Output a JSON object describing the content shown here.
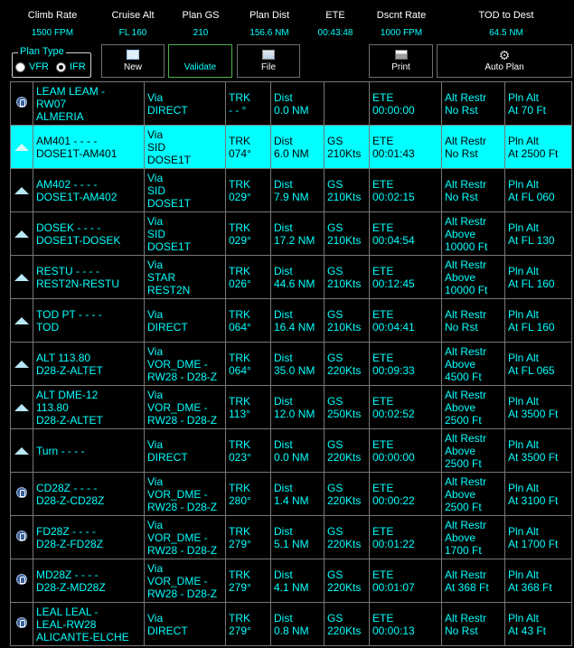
{
  "summary": [
    {
      "label": "Climb Rate",
      "value": "1500 FPM"
    },
    {
      "label": "Cruise Alt",
      "value": "FL 160"
    },
    {
      "label": "Plan GS",
      "value": "210"
    },
    {
      "label": "Plan Dist",
      "value": "156.6 NM"
    },
    {
      "label": "ETE",
      "value": "00:43:48"
    },
    {
      "label": "Dscnt Rate",
      "value": "1000 FPM"
    },
    {
      "label": "TOD to Dest",
      "value": "64.5 NM"
    }
  ],
  "plan_type": {
    "legend": "Plan Type",
    "vfr_label": "VFR",
    "ifr_label": "IFR",
    "selected": "IFR"
  },
  "toolbar": {
    "new_label": "New",
    "validate_label": "Validate",
    "file_label": "File",
    "print_label": "Print",
    "autoplan_label": "Auto Plan"
  },
  "rows": [
    {
      "icon": "airport-icon",
      "wpt": [
        "LEAM  LEAM -",
        "RW07",
        "ALMERIA"
      ],
      "via": [
        "Via",
        "DIRECT"
      ],
      "trk": [
        "TRK",
        "- - °"
      ],
      "dist": [
        "Dist",
        "0.0 NM"
      ],
      "gs": [],
      "ete": [
        "ETE",
        "00:00:00"
      ],
      "alt": [
        "Alt Restr",
        "No Rst"
      ],
      "pln": [
        "Pln Alt",
        "At 70 Ft"
      ],
      "selected": false
    },
    {
      "icon": "waypoint-icon",
      "wpt": [
        "AM401   - - - -",
        "DOSE1T-AM401"
      ],
      "via": [
        "Via",
        "SID",
        "DOSE1T"
      ],
      "trk": [
        "TRK",
        "074°"
      ],
      "dist": [
        "Dist",
        "6.0 NM"
      ],
      "gs": [
        "GS",
        "210Kts"
      ],
      "ete": [
        "ETE",
        "00:01:43"
      ],
      "alt": [
        "Alt Restr",
        "No Rst"
      ],
      "pln": [
        "Pln Alt",
        "At 2500 Ft"
      ],
      "selected": true
    },
    {
      "icon": "waypoint-icon",
      "wpt": [
        "AM402   - - - -",
        "DOSE1T-AM402"
      ],
      "via": [
        "Via",
        "SID",
        "DOSE1T"
      ],
      "trk": [
        "TRK",
        "029°"
      ],
      "dist": [
        "Dist",
        "7.9 NM"
      ],
      "gs": [
        "GS",
        "210Kts"
      ],
      "ete": [
        "ETE",
        "00:02:15"
      ],
      "alt": [
        "Alt Restr",
        "No Rst"
      ],
      "pln": [
        "Pln Alt",
        "At FL 060"
      ],
      "selected": false
    },
    {
      "icon": "waypoint-icon",
      "wpt": [
        "DOSEK   - - - -",
        "DOSE1T-DOSEK"
      ],
      "via": [
        "Via",
        "SID",
        "DOSE1T"
      ],
      "trk": [
        "TRK",
        "029°"
      ],
      "dist": [
        "Dist",
        "17.2 NM"
      ],
      "gs": [
        "GS",
        "210Kts"
      ],
      "ete": [
        "ETE",
        "00:04:54"
      ],
      "alt": [
        "Alt Restr",
        "Above",
        "10000 Ft"
      ],
      "pln": [
        "Pln Alt",
        "At FL 130"
      ],
      "selected": false
    },
    {
      "icon": "waypoint-icon",
      "wpt": [
        "RESTU   - - - -",
        "REST2N-RESTU"
      ],
      "via": [
        "Via",
        "STAR",
        "REST2N"
      ],
      "trk": [
        "TRK",
        "026°"
      ],
      "dist": [
        "Dist",
        "44.6 NM"
      ],
      "gs": [
        "GS",
        "210Kts"
      ],
      "ete": [
        "ETE",
        "00:12:45"
      ],
      "alt": [
        "Alt Restr",
        "Above",
        "10000 Ft"
      ],
      "pln": [
        "Pln Alt",
        "At FL 160"
      ],
      "selected": false
    },
    {
      "icon": "waypoint-icon",
      "wpt": [
        "TOD PT   - - - -",
        "TOD"
      ],
      "via": [
        "Via",
        "DIRECT"
      ],
      "trk": [
        "TRK",
        "064°"
      ],
      "dist": [
        "Dist",
        "16.4 NM"
      ],
      "gs": [
        "GS",
        "210Kts"
      ],
      "ete": [
        "ETE",
        "00:04:41"
      ],
      "alt": [
        "Alt Restr",
        "No Rst"
      ],
      "pln": [
        "Pln Alt",
        "At FL 160"
      ],
      "selected": false
    },
    {
      "icon": "waypoint-icon",
      "wpt": [
        "ALT   113.80",
        "D28-Z-ALTET"
      ],
      "via": [
        "Via",
        "VOR_DME -",
        "RW28 - D28-Z"
      ],
      "trk": [
        "TRK",
        "064°"
      ],
      "dist": [
        "Dist",
        "35.0 NM"
      ],
      "gs": [
        "GS",
        "220Kts"
      ],
      "ete": [
        "ETE",
        "00:09:33"
      ],
      "alt": [
        "Alt Restr",
        "Above",
        "4500 Ft"
      ],
      "pln": [
        "Pln Alt",
        "At FL 065"
      ],
      "selected": false
    },
    {
      "icon": "waypoint-icon",
      "wpt": [
        "ALT DME-12",
        "113.80",
        "D28-Z-ALTET"
      ],
      "via": [
        "Via",
        "VOR_DME -",
        "RW28 - D28-Z"
      ],
      "trk": [
        "TRK",
        "113°"
      ],
      "dist": [
        "Dist",
        "12.0 NM"
      ],
      "gs": [
        "GS",
        "250Kts"
      ],
      "ete": [
        "ETE",
        "00:02:52"
      ],
      "alt": [
        "Alt Restr",
        "Above",
        "2500 Ft"
      ],
      "pln": [
        "Pln Alt",
        "At 3500 Ft"
      ],
      "selected": false
    },
    {
      "icon": "waypoint-icon",
      "wpt": [
        "Turn   - - - -"
      ],
      "via": [
        "Via",
        "DIRECT"
      ],
      "trk": [
        "TRK",
        "023°"
      ],
      "dist": [
        "Dist",
        "0.0 NM"
      ],
      "gs": [
        "GS",
        "220Kts"
      ],
      "ete": [
        "ETE",
        "00:00:00"
      ],
      "alt": [
        "Alt Restr",
        "Above",
        "2500 Ft"
      ],
      "pln": [
        "Pln Alt",
        "At 3500 Ft"
      ],
      "selected": false
    },
    {
      "icon": "airport-icon",
      "wpt": [
        "CD28Z   - - - -",
        "D28-Z-CD28Z"
      ],
      "via": [
        "Via",
        "VOR_DME -",
        "RW28 - D28-Z"
      ],
      "trk": [
        "TRK",
        "280°"
      ],
      "dist": [
        "Dist",
        "1.4 NM"
      ],
      "gs": [
        "GS",
        "220Kts"
      ],
      "ete": [
        "ETE",
        "00:00:22"
      ],
      "alt": [
        "Alt Restr",
        "Above",
        "2500 Ft"
      ],
      "pln": [
        "Pln Alt",
        "At 3100 Ft"
      ],
      "selected": false
    },
    {
      "icon": "airport-icon",
      "wpt": [
        "FD28Z   - - - -",
        "D28-Z-FD28Z"
      ],
      "via": [
        "Via",
        "VOR_DME -",
        "RW28 - D28-Z"
      ],
      "trk": [
        "TRK",
        "279°"
      ],
      "dist": [
        "Dist",
        "5.1 NM"
      ],
      "gs": [
        "GS",
        "220Kts"
      ],
      "ete": [
        "ETE",
        "00:01:22"
      ],
      "alt": [
        "Alt Restr",
        "Above",
        "1700 Ft"
      ],
      "pln": [
        "Pln Alt",
        "At 1700 Ft"
      ],
      "selected": false
    },
    {
      "icon": "airport-icon",
      "wpt": [
        "MD28Z   - - - -",
        "D28-Z-MD28Z"
      ],
      "via": [
        "Via",
        "VOR_DME -",
        "RW28 - D28-Z"
      ],
      "trk": [
        "TRK",
        "279°"
      ],
      "dist": [
        "Dist",
        "4.1 NM"
      ],
      "gs": [
        "GS",
        "220Kts"
      ],
      "ete": [
        "ETE",
        "00:01:07"
      ],
      "alt": [
        "Alt Restr",
        "At 368 Ft"
      ],
      "pln": [
        "Pln Alt",
        "At 368 Ft"
      ],
      "selected": false
    },
    {
      "icon": "airport-icon",
      "wpt": [
        "LEAL  LEAL -",
        "LEAL-RW28",
        "ALICANTE-ELCHE"
      ],
      "via": [
        "Via",
        "DIRECT"
      ],
      "trk": [
        "TRK",
        "279°"
      ],
      "dist": [
        "Dist",
        "0.8 NM"
      ],
      "gs": [
        "GS",
        "220Kts"
      ],
      "ete": [
        "ETE",
        "00:00:13"
      ],
      "alt": [
        "Alt Restr",
        "No Rst"
      ],
      "pln": [
        "Pln Alt",
        "At 43 Ft"
      ],
      "selected": false
    }
  ]
}
